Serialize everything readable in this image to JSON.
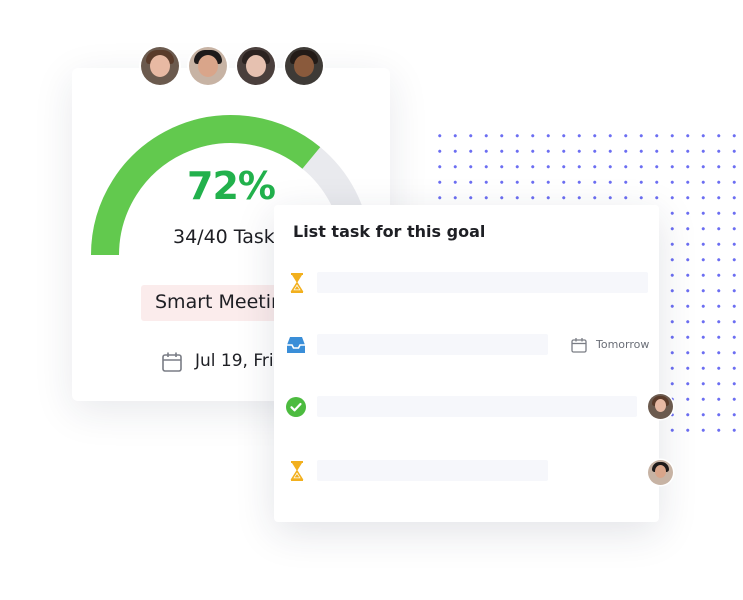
{
  "goal": {
    "progress_fraction": 0.72,
    "percent_label": "72%",
    "tasks_label": "34/40 Tasks",
    "tag_label": "Smart Meeting",
    "date_label": "Jul 19, Friday",
    "gauge_color": "#62c94e",
    "gauge_track_color": "#e9eaee",
    "tag_color": "#fbecec",
    "avatars": [
      {
        "name": "avatar-1",
        "bg": "#6b5a4e",
        "skin": "#e8b9a3",
        "hair": "#5a3b2a"
      },
      {
        "name": "avatar-2",
        "bg": "#c7b3a4",
        "skin": "#d9a58a",
        "hair": "#1d1a1a"
      },
      {
        "name": "avatar-3",
        "bg": "#4a3f3c",
        "skin": "#e6c1b0",
        "hair": "#2b2220"
      },
      {
        "name": "avatar-4",
        "bg": "#3e3a36",
        "skin": "#8a5a3c",
        "hair": "#231b17"
      }
    ]
  },
  "list": {
    "title": "List task for this goal",
    "rows": [
      {
        "icon": "hourglass-icon",
        "icon_color": "#f2b01e",
        "due": "",
        "assignee": ""
      },
      {
        "icon": "inbox-icon",
        "icon_color": "#3a8ed8",
        "due": "Tomorrow",
        "assignee": ""
      },
      {
        "icon": "check-circle-icon",
        "icon_color": "#4cbb3f",
        "due": "",
        "assignee": "avatar-1"
      },
      {
        "icon": "hourglass-icon",
        "icon_color": "#f2b01e",
        "due": "",
        "assignee": "avatar-2"
      }
    ]
  },
  "colors": {
    "accent_green": "#22b14c",
    "dot_pattern": "#6c6ef2"
  }
}
